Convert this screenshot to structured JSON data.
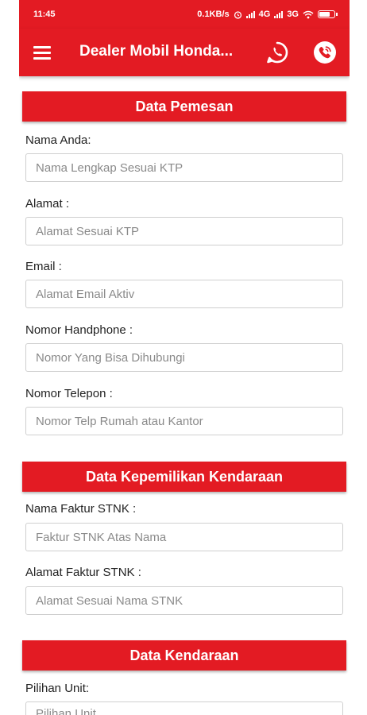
{
  "status": {
    "time": "11:45",
    "speed": "0.1KB/s",
    "net1": "4G",
    "net2": "3G"
  },
  "app": {
    "title": "Dealer Mobil Honda...",
    "theme_color": "#e31b23"
  },
  "icons": {
    "menu": "hamburger-menu-icon",
    "whatsapp": "whatsapp-icon",
    "call": "phone-call-icon"
  },
  "sections": [
    {
      "title": "Data Pemesan"
    },
    {
      "title": "Data Kepemilikan Kendaraan"
    },
    {
      "title": "Data Kendaraan"
    }
  ],
  "fields": [
    {
      "label": "Nama Anda:",
      "placeholder": "Nama Lengkap Sesuai KTP"
    },
    {
      "label": "Alamat :",
      "placeholder": "Alamat Sesuai KTP"
    },
    {
      "label": "Email :",
      "placeholder": "Alamat Email Aktiv"
    },
    {
      "label": "Nomor Handphone :",
      "placeholder": "Nomor Yang Bisa Dihubungi"
    },
    {
      "label": "Nomor Telepon :",
      "placeholder": "Nomor Telp Rumah atau Kantor"
    },
    {
      "label": "Nama Faktur STNK :",
      "placeholder": "Faktur STNK Atas Nama"
    },
    {
      "label": "Alamat Faktur STNK :",
      "placeholder": "Alamat Sesuai Nama STNK"
    },
    {
      "label": "Pilihan Unit:",
      "value": "Pilihan Unit"
    }
  ]
}
